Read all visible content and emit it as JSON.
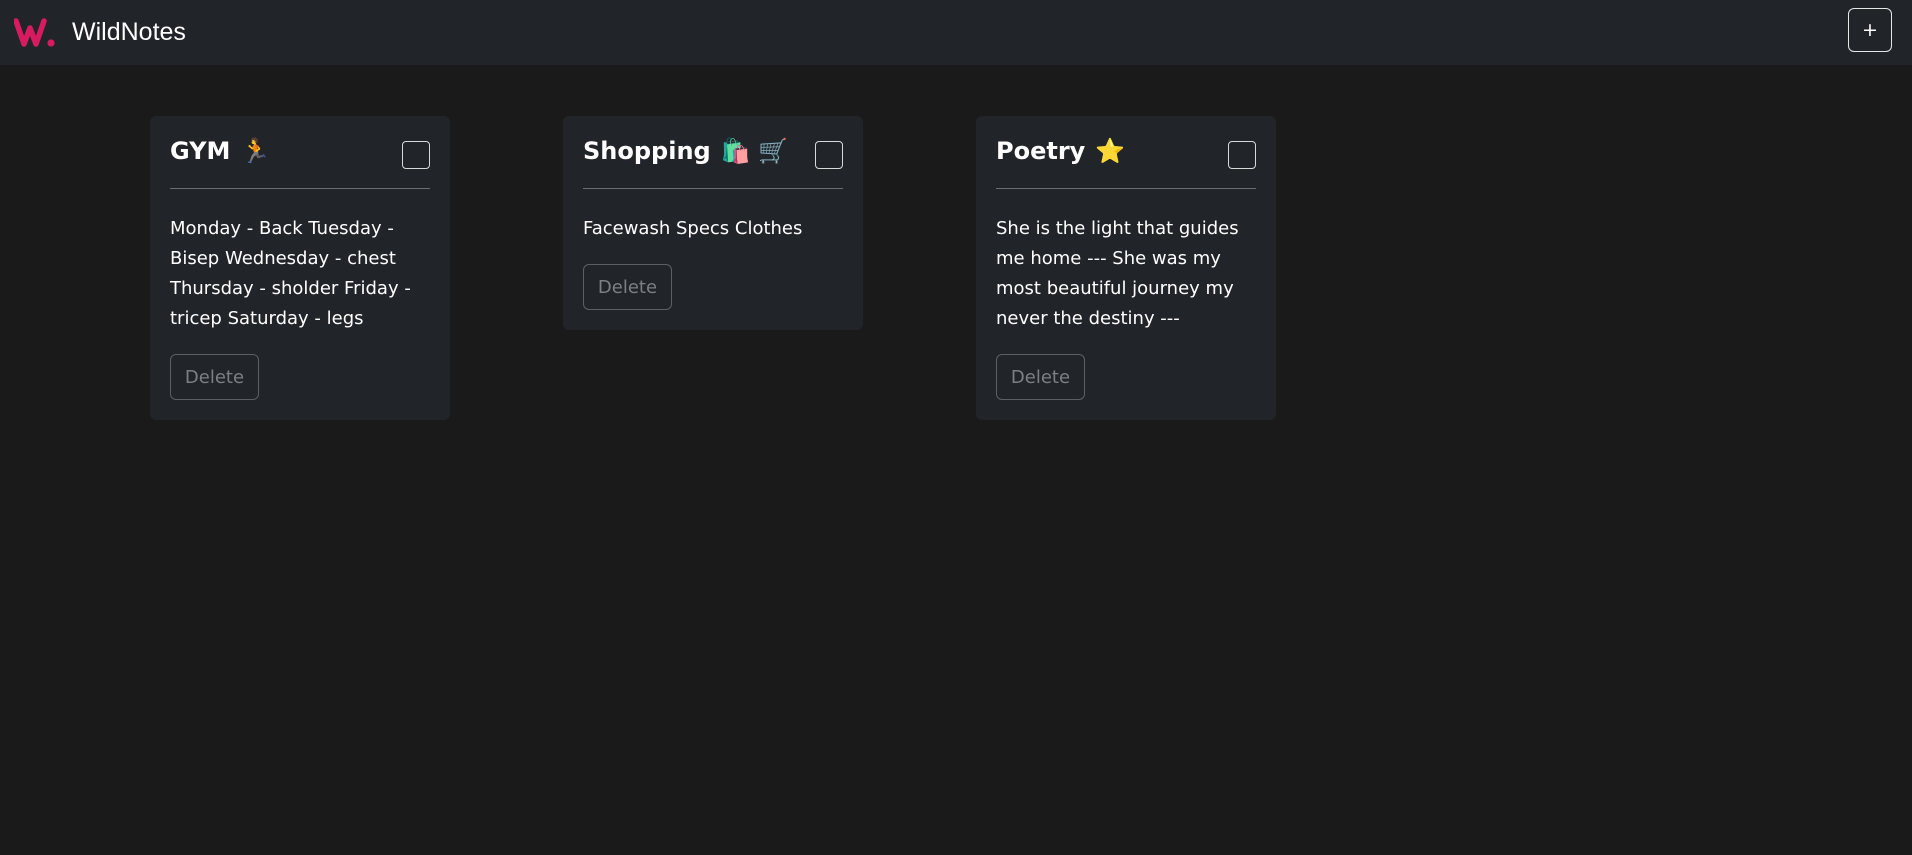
{
  "app": {
    "title": "WildNotes",
    "add_label": "+",
    "accent_color": "#d81b60"
  },
  "notes": [
    {
      "title": "GYM",
      "emoji": "🏃",
      "body": "Monday - Back Tuesday - Bisep Wednesday - chest Thursday - sholder Friday - tricep Saturday - legs",
      "checked": false,
      "delete_label": "Delete"
    },
    {
      "title": "Shopping",
      "emoji": "🛍️ 🛒",
      "body": "Facewash Specs Clothes",
      "checked": false,
      "delete_label": "Delete"
    },
    {
      "title": "Poetry",
      "emoji": "⭐",
      "body": "She is the light that guides me home --- She was my most beautiful journey my never the destiny ---",
      "checked": false,
      "delete_label": "Delete"
    }
  ]
}
